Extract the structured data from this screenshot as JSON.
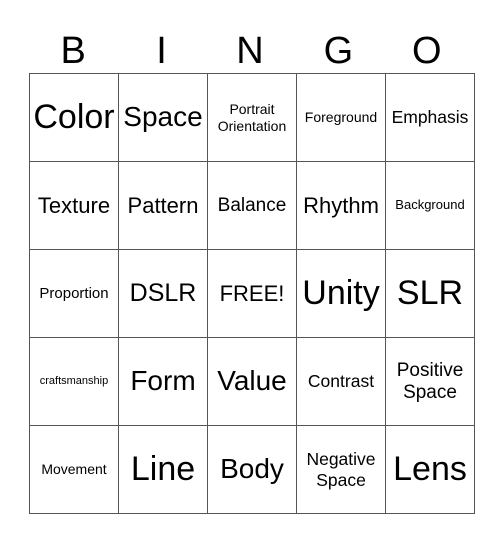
{
  "header": {
    "letters": [
      "B",
      "I",
      "N",
      "G",
      "O"
    ]
  },
  "grid": {
    "rows": [
      [
        "Color",
        "Space",
        "Portrait Orientation",
        "Foreground",
        "Emphasis"
      ],
      [
        "Texture",
        "Pattern",
        "Balance",
        "Rhythm",
        "Background"
      ],
      [
        "Proportion",
        "DSLR",
        "FREE!",
        "Unity",
        "SLR"
      ],
      [
        "craftsmanship",
        "Form",
        "Value",
        "Contrast",
        "Positive Space"
      ],
      [
        "Movement",
        "Line",
        "Body",
        "Negative Space",
        "Lens"
      ]
    ],
    "free_space": "FREE!"
  }
}
